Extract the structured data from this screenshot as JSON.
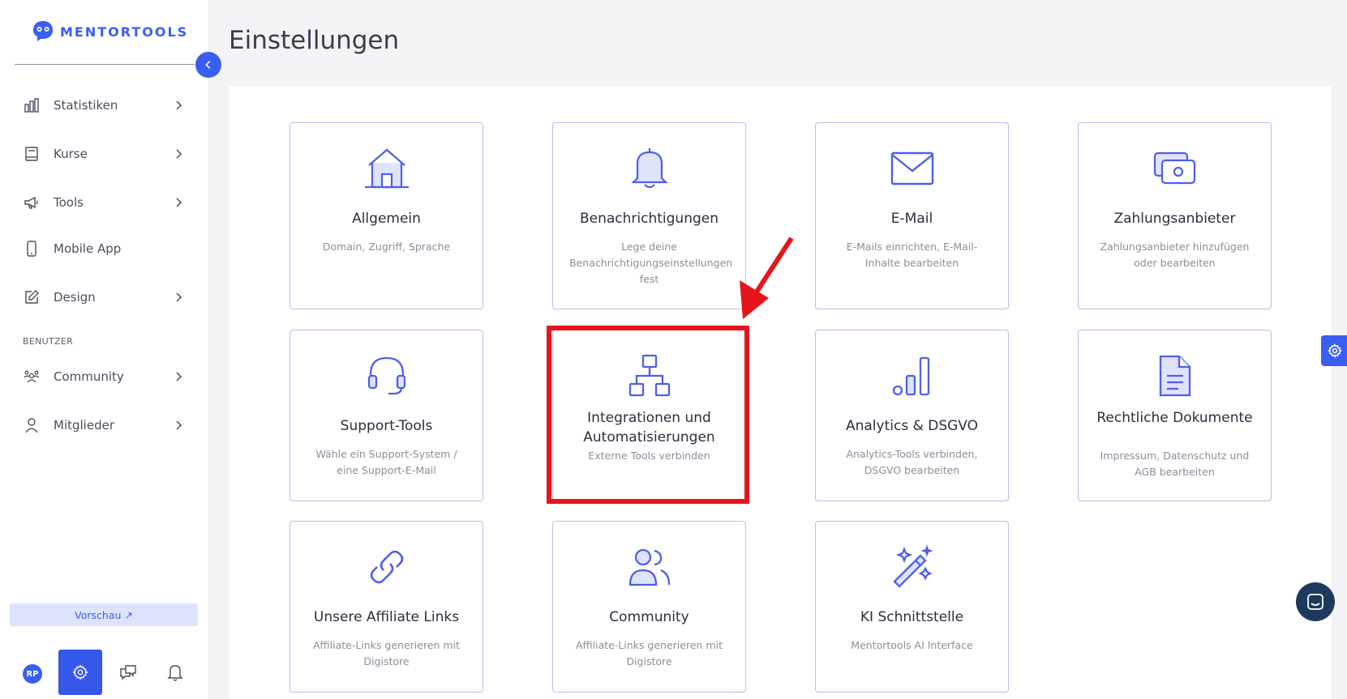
{
  "brand": {
    "name": "MENTORTOOLS",
    "accent": "#3b5ef2"
  },
  "sidebar": {
    "items": [
      {
        "label": "Statistiken",
        "icon": "bar-chart-icon"
      },
      {
        "label": "Kurse",
        "icon": "book-icon"
      },
      {
        "label": "Tools",
        "icon": "megaphone-icon"
      },
      {
        "label": "Mobile App",
        "icon": "mobile-icon"
      },
      {
        "label": "Design",
        "icon": "pencil-icon"
      }
    ],
    "section_label": "BENUTZER",
    "user_items": [
      {
        "label": "Community",
        "icon": "users-icon"
      },
      {
        "label": "Mitglieder",
        "icon": "user-icon"
      }
    ],
    "preview_label": "Vorschau ↗",
    "avatar_initials": "RP"
  },
  "page": {
    "title": "Einstellungen"
  },
  "cards": [
    {
      "title": "Allgemein",
      "desc": "Domain, Zugriff, Sprache",
      "icon": "home-icon"
    },
    {
      "title": "Benachrichtigungen",
      "desc": "Lege deine Benachrichtigungseinstellungen fest",
      "icon": "bell-icon"
    },
    {
      "title": "E-Mail",
      "desc": "E-Mails einrichten, E-Mail-Inhalte bearbeiten",
      "icon": "mail-icon"
    },
    {
      "title": "Zahlungsanbieter",
      "desc": "Zahlungsanbieter hinzufügen oder bearbeiten",
      "icon": "money-icon"
    },
    {
      "title": "Support-Tools",
      "desc": "Wähle ein Support-System / eine Support-E-Mail",
      "icon": "headset-icon"
    },
    {
      "title": "Integrationen und Automatisierungen",
      "desc": "Externe Tools verbinden",
      "icon": "sitemap-icon"
    },
    {
      "title": "Analytics & DSGVO",
      "desc": "Analytics-Tools verbinden, DSGVO bearbeiten",
      "icon": "analytics-icon"
    },
    {
      "title": "Rechtliche Dokumente",
      "desc": "Impressum, Datenschutz und AGB bearbeiten",
      "icon": "document-icon"
    },
    {
      "title": "Unsere Affiliate Links",
      "desc": "Affiliate-Links generieren mit Digistore",
      "icon": "link-icon"
    },
    {
      "title": "Community",
      "desc": "Affiliate-Links generieren mit Digistore",
      "icon": "users-icon"
    },
    {
      "title": "KI Schnittstelle",
      "desc": "Mentortools AI Interface",
      "icon": "magic-wand-icon"
    }
  ],
  "colors": {
    "highlight": "#e8141b",
    "card_border": "#b9bcf2",
    "icon": "#4f5fe8"
  }
}
